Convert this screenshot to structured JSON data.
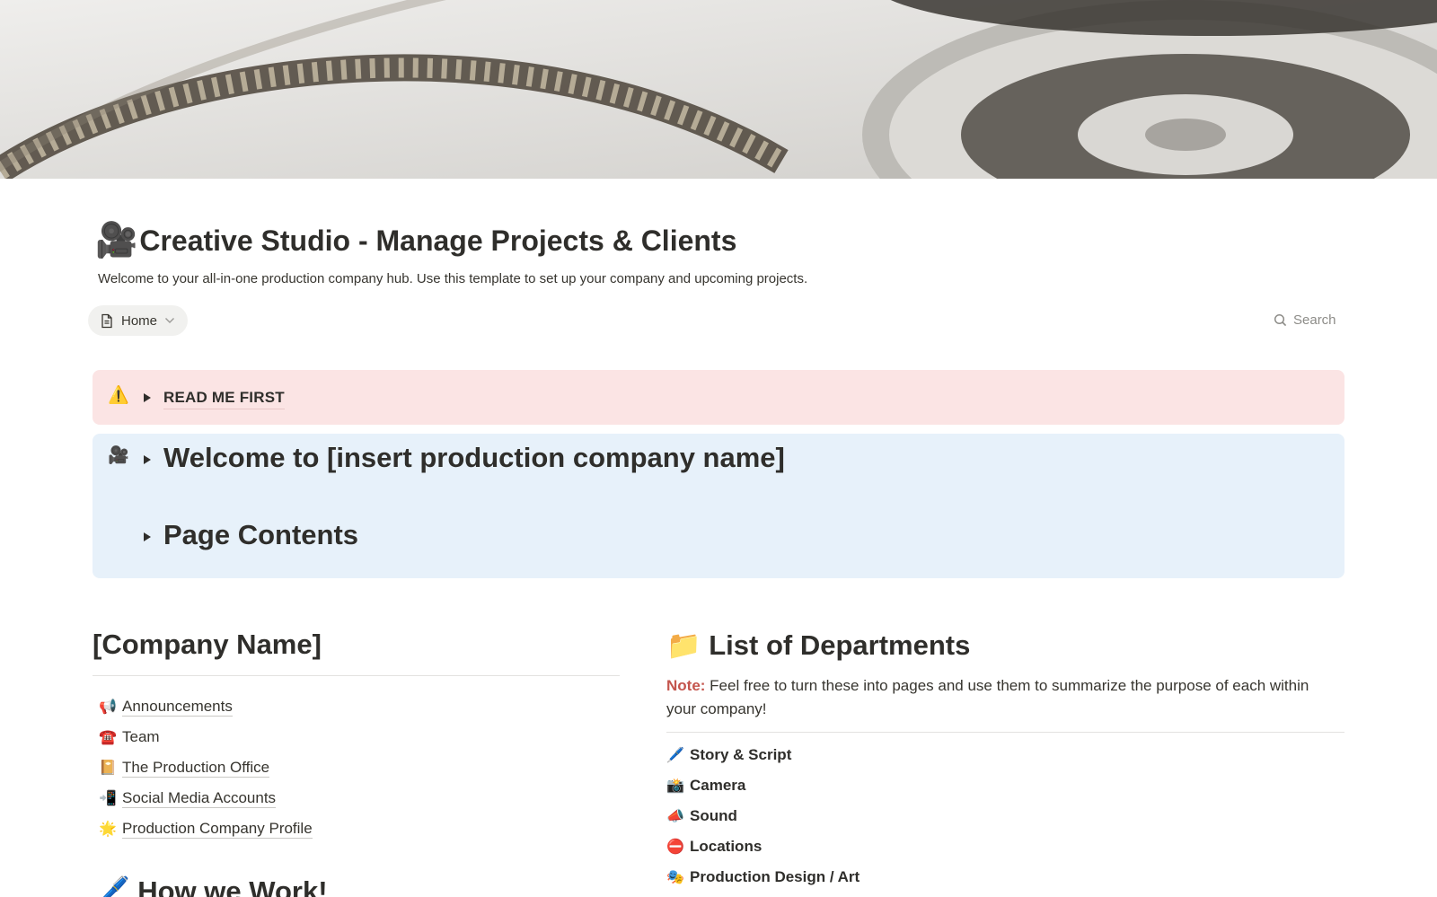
{
  "page": {
    "title_emoji": "🎥",
    "title": "Creative Studio - Manage Projects & Clients",
    "subtitle": "Welcome to your all-in-one production company hub. Use this template to set up your company and upcoming projects."
  },
  "toolbar": {
    "view_label": "Home",
    "view_icon": "document-icon",
    "search_label": "Search"
  },
  "callouts": [
    {
      "emoji": "⚠️",
      "toggles": [
        "READ ME FIRST"
      ],
      "color": "#fbe4e4"
    },
    {
      "emoji": "🎥",
      "toggles": [
        "Welcome to [insert production company name]",
        "Page Contents"
      ],
      "color": "#e7f1fa"
    }
  ],
  "left_section": {
    "heading": "[Company Name]",
    "links": [
      {
        "emoji": "📢",
        "label": "Announcements"
      },
      {
        "emoji": "☎️",
        "label": "Team"
      },
      {
        "emoji": "📔",
        "label": "The Production Office"
      },
      {
        "emoji": "📲",
        "label": "Social Media Accounts"
      },
      {
        "emoji": "🌟",
        "label": "Production Company Profile"
      }
    ],
    "next_heading_emoji": "🖊️",
    "next_heading": "How we Work!"
  },
  "right_section": {
    "heading_emoji": "📁",
    "heading": "List of Departments",
    "note_label": "Note:",
    "note_text": " Feel free to turn these into pages and use them to summarize the purpose of each within your company!",
    "departments": [
      {
        "emoji": "🖊️",
        "label": "Story & Script"
      },
      {
        "emoji": "📸",
        "label": "Camera"
      },
      {
        "emoji": "📣",
        "label": "Sound"
      },
      {
        "emoji": "⛔",
        "label": "Locations"
      },
      {
        "emoji": "🎭",
        "label": "Production Design / Art"
      }
    ]
  }
}
